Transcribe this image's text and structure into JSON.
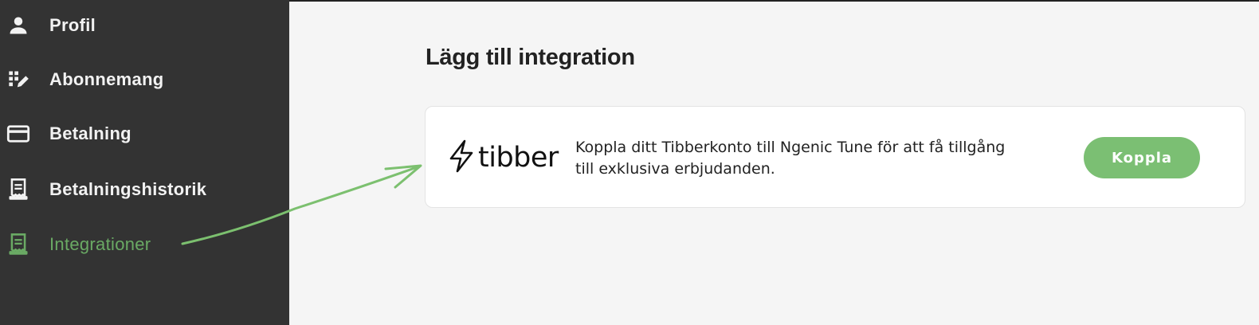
{
  "sidebar": {
    "items": [
      {
        "label": "Profil",
        "icon": "person-icon"
      },
      {
        "label": "Abonnemang",
        "icon": "grid-pencil-icon"
      },
      {
        "label": "Betalning",
        "icon": "credit-card-icon"
      },
      {
        "label": "Betalningshistorik",
        "icon": "receipt-icon"
      },
      {
        "label": "Integrationer",
        "icon": "receipt-icon",
        "active": true
      }
    ]
  },
  "main": {
    "title": "Lägg till integration",
    "integration": {
      "logo_text": "tibber",
      "description_line1": "Koppla ditt Tibberkonto till Ngenic Tune för att få tillgång",
      "description_line2": "till exklusiva erbjudanden.",
      "button_label": "Koppla"
    }
  },
  "colors": {
    "sidebar_bg": "#333333",
    "active": "#6aaa64",
    "button": "#7bbf73",
    "annotation_arrow": "#7cc06f"
  }
}
